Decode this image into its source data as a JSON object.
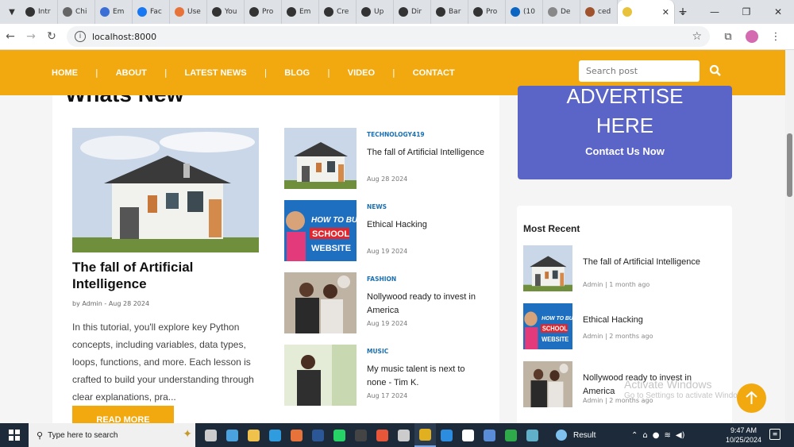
{
  "browser": {
    "tabs": [
      {
        "label": "Intr",
        "icon": "github-icon",
        "color": "#333333"
      },
      {
        "label": "Chi",
        "icon": "chrome-icon",
        "color": "#666666"
      },
      {
        "label": "Em",
        "icon": "email-icon",
        "color": "#3b6fd6"
      },
      {
        "label": "Fac",
        "icon": "facebook-icon",
        "color": "#1877f2"
      },
      {
        "label": "Use",
        "icon": "user-icon",
        "color": "#e8733a"
      },
      {
        "label": "You",
        "icon": "up-icon",
        "color": "#333333"
      },
      {
        "label": "Pro",
        "icon": "up-icon",
        "color": "#333333"
      },
      {
        "label": "Em",
        "icon": "up-icon",
        "color": "#333333"
      },
      {
        "label": "Cre",
        "icon": "up-icon",
        "color": "#333333"
      },
      {
        "label": "Up",
        "icon": "up-icon",
        "color": "#333333"
      },
      {
        "label": "Dir",
        "icon": "up-icon",
        "color": "#333333"
      },
      {
        "label": "Bar",
        "icon": "up-icon",
        "color": "#333333"
      },
      {
        "label": "Pro",
        "icon": "up-icon",
        "color": "#333333"
      },
      {
        "label": "(10",
        "icon": "linkedin-icon",
        "color": "#0a66c2"
      },
      {
        "label": "De",
        "icon": "redirect-icon",
        "color": "#888888"
      },
      {
        "label": "ced",
        "icon": "site-icon",
        "color": "#a0522d"
      }
    ],
    "active_tab_icon": "emoji-icon",
    "url": "localhost:8000"
  },
  "nav": {
    "links": [
      "HOME",
      "ABOUT",
      "LATEST NEWS",
      "BLOG",
      "VIDEO",
      "CONTACT"
    ],
    "search_placeholder": "Search post"
  },
  "section_title": "Whats New",
  "featured": {
    "title": "The fall of Artificial Intelligence",
    "meta": "by Admin - Aug 28 2024",
    "excerpt": "In this tutorial, you'll explore key Python concepts, including variables, data types, loops, functions, and more. Each lesson is crafted to build your understanding through clear explanations, pra...",
    "read_more": "READ MORE"
  },
  "posts": [
    {
      "category": "TECHNOLOGY419",
      "title": "The fall of Artificial Intelligence",
      "date": "Aug 28 2024",
      "image": "house"
    },
    {
      "category": "NEWS",
      "title": "Ethical Hacking",
      "date": "Aug 19 2024",
      "image": "hacking"
    },
    {
      "category": "FASHION",
      "title": "Nollywood ready to invest in America",
      "date": "Aug 19 2024",
      "image": "people"
    },
    {
      "category": "MUSIC",
      "title": "My music talent is next to none - Tim K.",
      "date": "Aug 17 2024",
      "image": "music"
    }
  ],
  "advert": {
    "line1": "ADVERTISE",
    "line2": "HERE",
    "cta": "Contact Us Now"
  },
  "most_recent": {
    "title": "Most Recent",
    "items": [
      {
        "title": "The fall of Artificial Intelligence",
        "meta": "Admin | 1 month ago",
        "image": "house"
      },
      {
        "title": "Ethical Hacking",
        "meta": "Admin | 2 months ago",
        "image": "hacking"
      },
      {
        "title": "Nollywood ready to invest in America",
        "meta": "Admin | 2 months ago",
        "image": "people"
      }
    ]
  },
  "thumb_text": {
    "line1": "HOW TO BU",
    "line2": "SCHOOL",
    "line3": "WEBSITE"
  },
  "watermark": {
    "line1": "Activate Windows",
    "line2": "Go to Settings to activate Windows."
  },
  "taskbar": {
    "search_placeholder": "Type here to search",
    "apps": [
      "task-view-icon",
      "mail-icon",
      "file-explorer-icon",
      "edge-icon",
      "xampp-icon",
      "word-icon",
      "whatsapp-icon",
      "app-icon",
      "app-icon",
      "app-icon",
      "chrome-icon",
      "vscode-icon",
      "app-icon",
      "store-icon",
      "app-icon",
      "app-icon"
    ],
    "app_colors": [
      "#cccccc",
      "#4aa3df",
      "#f0c24b",
      "#2f9ce0",
      "#e8733a",
      "#2b5797",
      "#25d366",
      "#444444",
      "#e8563a",
      "#cccccc",
      "#e0b020",
      "#2c8de0",
      "#ffffff",
      "#5a8dd8",
      "#2faa4a",
      "#5fb0c8"
    ],
    "active_app": 10,
    "result_label": "Result",
    "time": "9:47 AM",
    "date": "10/25/2024"
  },
  "colors": {
    "accent": "#f2a90f",
    "advert": "#5b64c7",
    "category": "#1a6fb0"
  }
}
